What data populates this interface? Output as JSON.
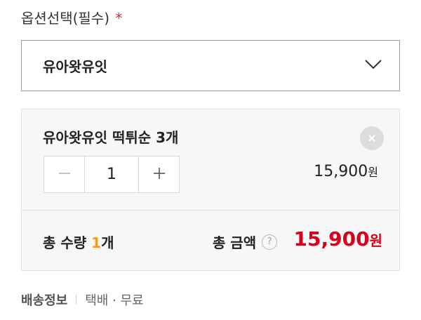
{
  "option": {
    "label": "옵션선택(필수)",
    "required_mark": "*",
    "selected_value": "유아왓유잇"
  },
  "selected_item": {
    "name": "유아왓유잇 떡튀순 3개",
    "quantity": "1",
    "price": "15,900",
    "price_unit": "원"
  },
  "summary": {
    "total_qty_prefix": "총 수량 ",
    "total_qty_value": "1",
    "total_qty_suffix": "개",
    "total_amount_label": "총 금액",
    "help_glyph": "?",
    "total_amount": "15,900",
    "total_amount_unit": "원"
  },
  "shipping": {
    "label": "배송정보",
    "value": "택배 · 무료"
  },
  "colors": {
    "required": "#e0272d",
    "qty_highlight": "#f39c1f",
    "total_price": "#d6001c"
  },
  "icons": {
    "dropdown": "chevron-down-icon",
    "remove": "close-icon",
    "decrement": "minus-icon",
    "increment": "plus-icon",
    "help": "question-icon"
  }
}
